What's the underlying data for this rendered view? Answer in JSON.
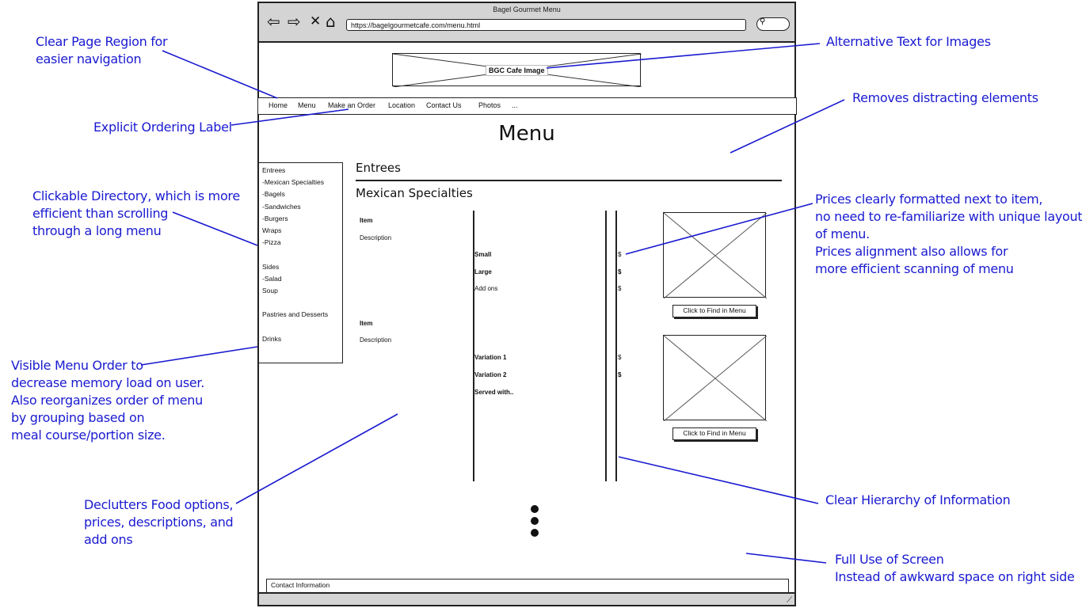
{
  "window": {
    "title": "Bagel Gourmet Menu",
    "url": "https://bagelgourmetcafe.com/menu.html"
  },
  "banner": {
    "alt_text": "BGC Cafe Image"
  },
  "nav": {
    "items": [
      "Home",
      "Menu",
      "Make an Order",
      "Location",
      "Contact Us",
      "Photos",
      "..."
    ]
  },
  "page": {
    "title": "Menu",
    "section": "Entrees",
    "subsection": "Mexican Specialties"
  },
  "sidebar": {
    "items": [
      "Entrees",
      "-Mexican Specialties",
      "-Bagels",
      "-Sandwiches",
      "-Burgers",
      "Wraps",
      "-Pizza",
      "Sides",
      "-Salad",
      "Soup",
      "Pastries and Desserts",
      "Drinks"
    ]
  },
  "menu": {
    "item1": {
      "item": "Item",
      "description": "Description",
      "options": [
        "Small",
        "Large",
        "Add ons"
      ],
      "prices": [
        "$",
        "$",
        "$"
      ]
    },
    "item2": {
      "item": "Item",
      "description": "Description",
      "options": [
        "Variation 1",
        "Variation 2",
        "Served with.."
      ],
      "prices": [
        "$",
        "$"
      ]
    },
    "find_button": "Click to Find in Menu"
  },
  "footer": {
    "label": "Contact Information"
  },
  "annotations": {
    "page_region": [
      "Clear Page Region for",
      "easier navigation"
    ],
    "ordering_label": [
      "Explicit Ordering Label"
    ],
    "directory": [
      "Clickable Directory, which is more",
      "efficient than scrolling",
      "through a long menu"
    ],
    "menu_order": [
      "Visible Menu Order to",
      "decrease memory load on user.",
      "Also reorganizes order of menu",
      "by grouping based on",
      "meal course/portion size."
    ],
    "declutter": [
      "Declutters Food options,",
      "prices, descriptions, and",
      "add ons"
    ],
    "alt_text": [
      "Alternative Text for Images"
    ],
    "distracting": [
      "Removes distracting elements"
    ],
    "prices": [
      "Prices clearly formatted next to item,",
      "no need to re-familiarize with unique layout",
      "of menu.",
      "Prices alignment also allows for",
      "more efficient scanning of menu"
    ],
    "hierarchy": [
      "Clear Hierarchy of Information"
    ],
    "full_screen": [
      "Full Use of Screen",
      "Instead of awkward space on right side"
    ]
  },
  "colors": {
    "annotation": "#1a1ad0",
    "chrome": "#d4d4d4",
    "outline": "#222222"
  },
  "icons": [
    "back-arrow-icon",
    "forward-arrow-icon",
    "close-icon",
    "home-icon",
    "search-icon",
    "resize-grip-icon",
    "image-placeholder-icon"
  ]
}
